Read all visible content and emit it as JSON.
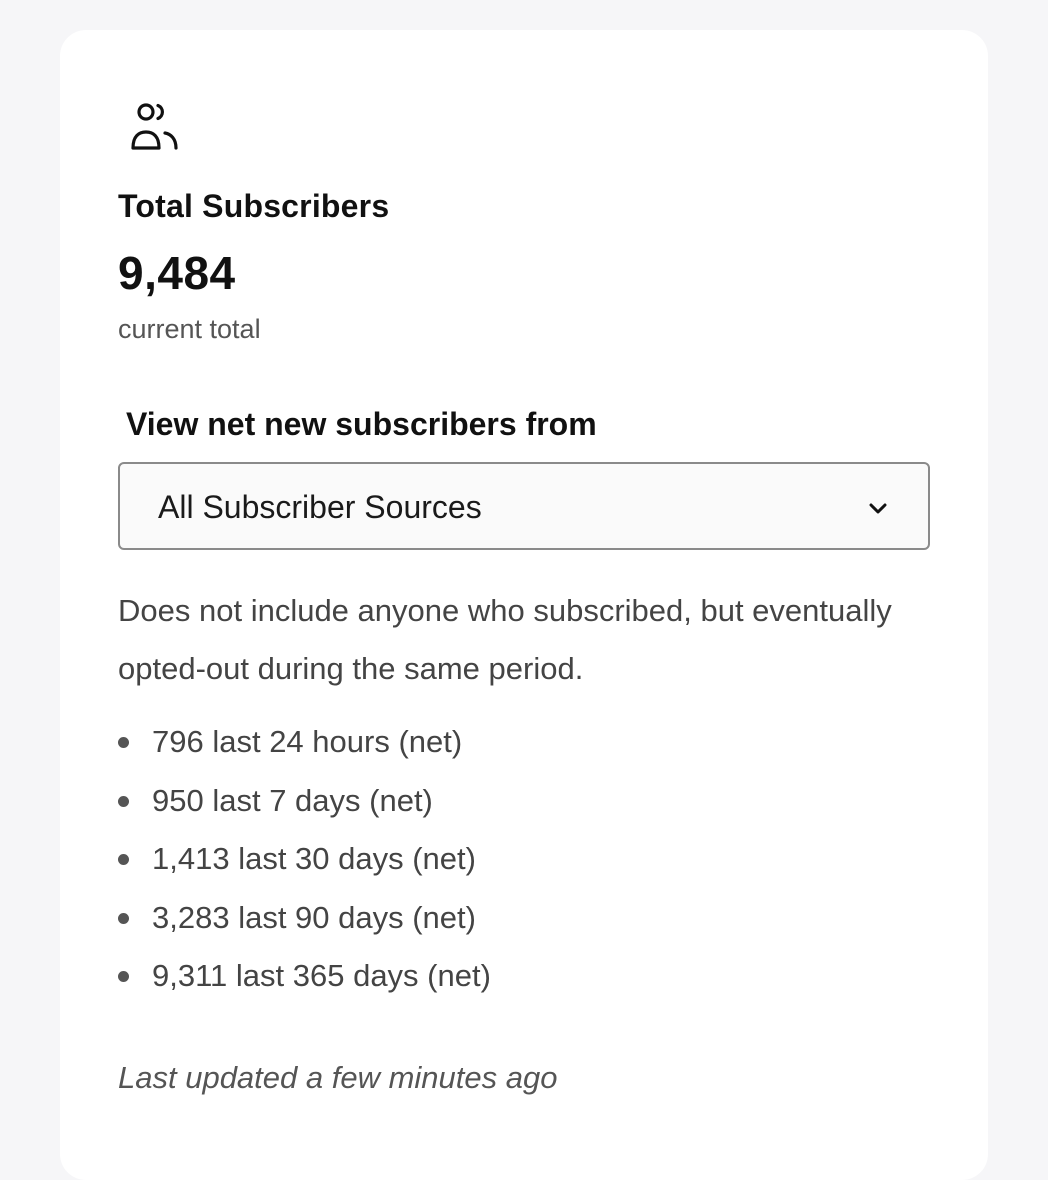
{
  "card": {
    "icon": "users-icon",
    "title": "Total Subscribers",
    "total": "9,484",
    "total_caption": "current total"
  },
  "filter": {
    "label": "View net new subscribers from",
    "selected": "All Subscriber Sources",
    "chevron_icon": "chevron-down-icon"
  },
  "description": "Does not include anyone who subscribed, but eventually opted-out during the same period.",
  "stats": [
    {
      "text": "796 last 24 hours (net)"
    },
    {
      "text": "950 last 7 days (net)"
    },
    {
      "text": "1,413 last 30 days (net)"
    },
    {
      "text": "3,283 last 90 days (net)"
    },
    {
      "text": "9,311 last 365 days (net)"
    }
  ],
  "footer": {
    "updated": "Last updated a few minutes ago"
  }
}
